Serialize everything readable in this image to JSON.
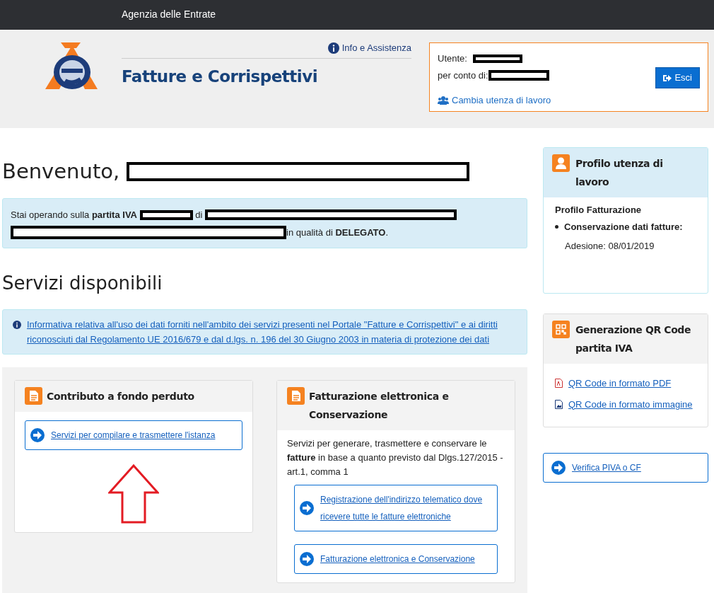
{
  "topbar": {
    "title": "Agenzia delle Entrate"
  },
  "header": {
    "app_title": "Fatture e Corrispettivi",
    "help_link": "Info e Assistenza",
    "user_box": {
      "user_label": "Utente:",
      "on_behalf_label": "per conto di:",
      "change_link": "Cambia utenza di lavoro",
      "logout_button": "Esci"
    }
  },
  "welcome": {
    "heading": "Benvenuto,"
  },
  "operating_alert": {
    "parts": [
      {
        "kind": "text",
        "text": "Stai operando sulla **partita IVA**"
      },
      {
        "kind": "redacted"
      },
      {
        "kind": "text",
        "text": "di"
      },
      {
        "kind": "redacted"
      },
      {
        "kind": "redacted"
      },
      {
        "kind": "text",
        "text": "in qualità di **DELEGATO**."
      }
    ]
  },
  "services_heading": "Servizi disponibili",
  "privacy_alert": {
    "link": "Informativa relativa all'uso dei dati forniti nell'ambito dei servizi presenti nel Portale \"Fatture e Corrispettivi\" e ai diritti riconosciuti dal Regolamento UE 2016/679 e dal d.lgs. n. 196 del 30 Giugno 2003 in materia di protezione dei dati"
  },
  "service_cards": [
    {
      "title": "Contributo a fondo perduto",
      "links": [
        "Servizi per compilare e trasmettere l'istanza"
      ]
    },
    {
      "title": "Fatturazione elettronica e Conservazione",
      "description": "Servizi per generare, trasmettere e conservare le **fatture** in base a quanto previsto dal Dlgs.127/2015 - art.1, comma 1",
      "links": [
        "Registrazione dell'indirizzo telematico dove ricevere tutte le fatture elettroniche",
        "Fatturazione elettronica e Conservazione"
      ]
    }
  ],
  "profile_card": {
    "title": "Profilo utenza di lavoro",
    "profile": "Profilo Fatturazione",
    "items": [
      {
        "label": "Conservazione dati fatture:",
        "detail": "Adesione: 08/01/2019"
      }
    ]
  },
  "qr_card": {
    "title": "Generazione QR Code partita IVA",
    "links": [
      {
        "kind": "pdf",
        "text": "QR Code in formato PDF"
      },
      {
        "kind": "image",
        "text": "QR Code in formato immagine"
      }
    ]
  },
  "verify_link": "Verifica PIVA o CF"
}
